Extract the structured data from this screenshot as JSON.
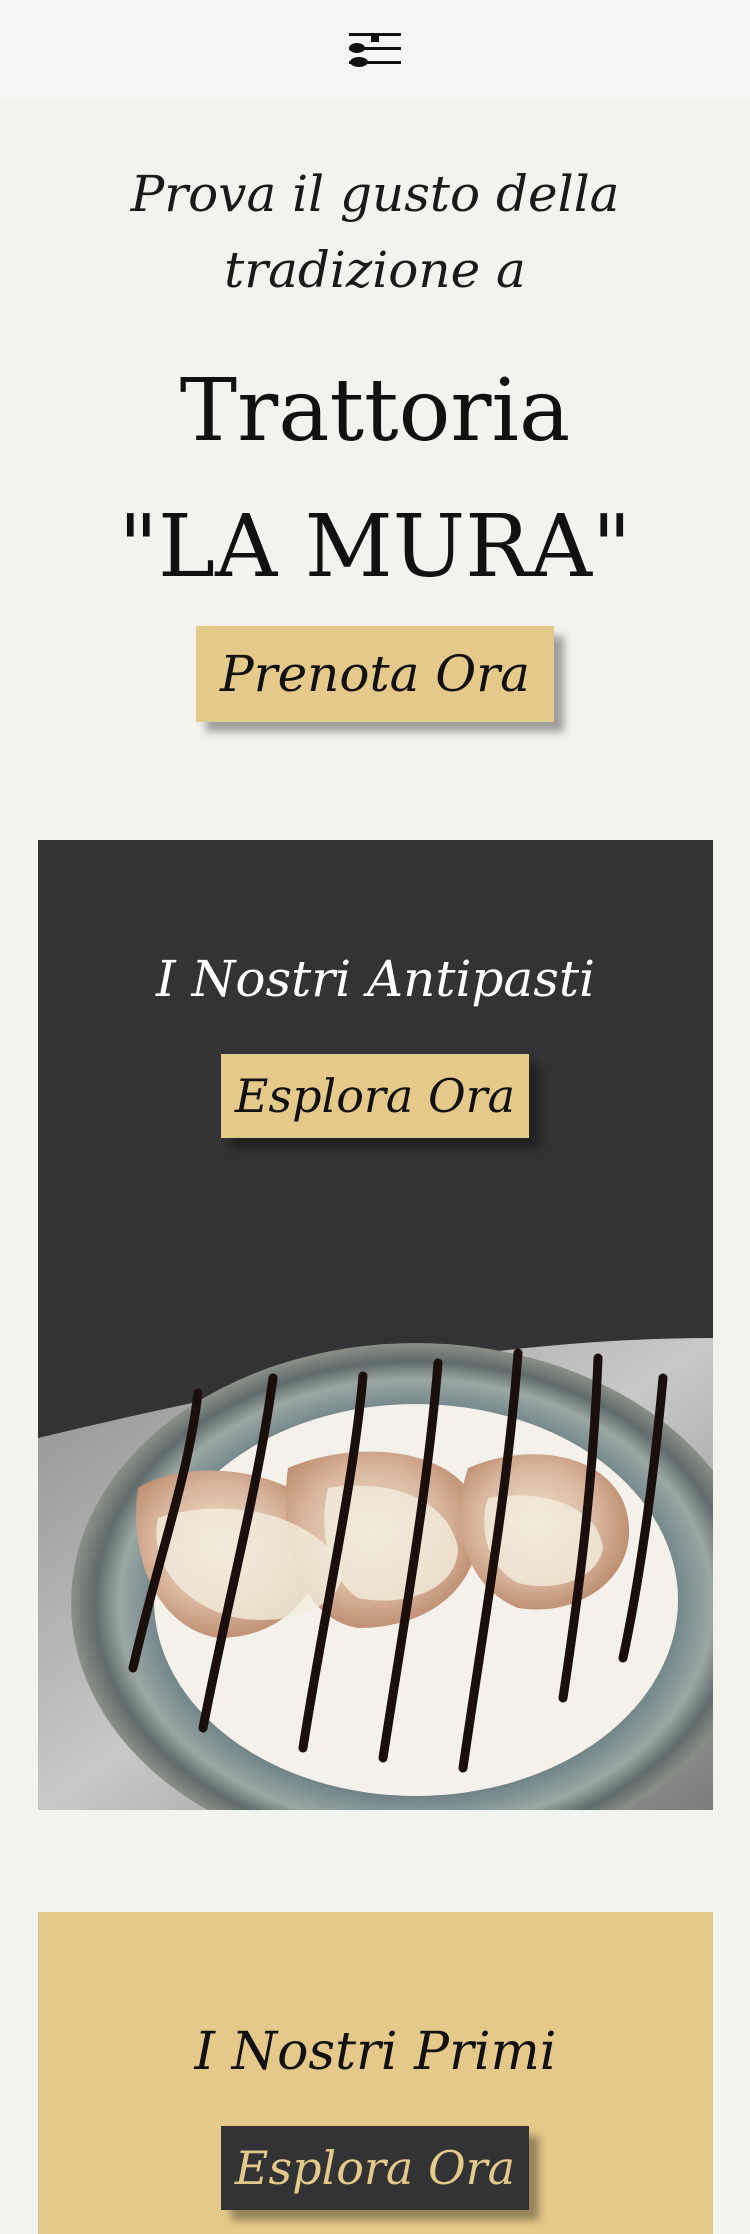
{
  "header": {
    "menu_icon": "fork-knife-menu-icon"
  },
  "hero": {
    "tagline": "Prova il gusto della tradizione a",
    "title_line1": "Trattoria",
    "title_line2": "\"LA MURA\"",
    "cta_label": "Prenota Ora"
  },
  "sections": [
    {
      "title": "I Nostri Antipasti",
      "button_label": "Esplora Ora",
      "background": "#333234",
      "image": "plate-of-filled-pasta-with-cream-sauce-and-balsamic-drizzle"
    },
    {
      "title": "I Nostri Primi",
      "button_label": "Esplora Ora",
      "background": "#e5c98a"
    }
  ],
  "colors": {
    "accent_gold": "#e5c98a",
    "dark": "#333234",
    "page_bg": "#f2f2ef"
  }
}
